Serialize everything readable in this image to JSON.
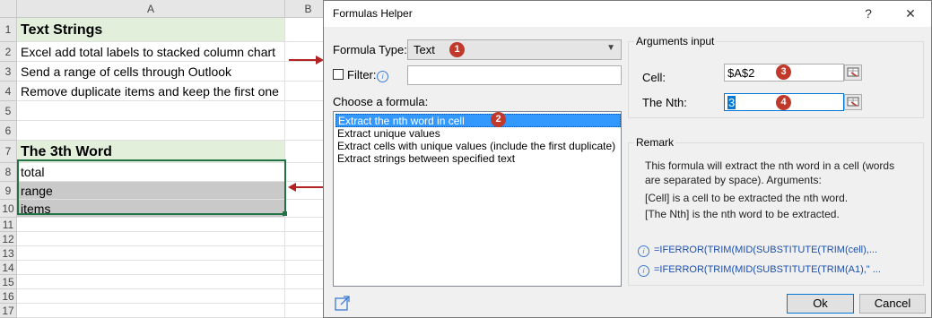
{
  "sheet": {
    "columns": [
      "A",
      "B"
    ],
    "rows": [
      {
        "num": "1",
        "text": "Text Strings"
      },
      {
        "num": "2",
        "text": "Excel add total labels to stacked column chart"
      },
      {
        "num": "3",
        "text": "Send a range of cells through Outlook"
      },
      {
        "num": "4",
        "text": "Remove duplicate items and keep the first one"
      },
      {
        "num": "5",
        "text": ""
      },
      {
        "num": "6",
        "text": ""
      },
      {
        "num": "7",
        "text": "The 3th Word"
      },
      {
        "num": "8",
        "text": "total"
      },
      {
        "num": "9",
        "text": "range"
      },
      {
        "num": "10",
        "text": "items"
      },
      {
        "num": "11",
        "text": ""
      },
      {
        "num": "12",
        "text": ""
      },
      {
        "num": "13",
        "text": ""
      },
      {
        "num": "14",
        "text": ""
      },
      {
        "num": "15",
        "text": ""
      },
      {
        "num": "16",
        "text": ""
      },
      {
        "num": "17",
        "text": ""
      }
    ]
  },
  "dialog": {
    "title": "Formulas Helper",
    "help_glyph": "?",
    "close_glyph": "✕",
    "formula_type_label": "Formula Type:",
    "formula_type_value": "Text",
    "filter_label": "Filter:",
    "choose_label": "Choose a formula:",
    "formulas": [
      "Extract the nth word in cell",
      "Extract unique values",
      "Extract cells with unique values (include the first duplicate)",
      "Extract strings between specified text"
    ],
    "selected_formula_index": 0,
    "arguments_title": "Arguments input",
    "cell_label": "Cell:",
    "cell_value": "$A$2",
    "nth_label": "The Nth:",
    "nth_value": "3",
    "remark_title": "Remark",
    "remark_lines": [
      "This formula will extract the nth word in a cell (words",
      "are separated by space). Arguments:",
      "[Cell] is a cell to be extracted the nth word.",
      "[The Nth] is the nth word to be extracted."
    ],
    "formula_previews": [
      "=IFERROR(TRIM(MID(SUBSTITUTE(TRIM(cell),...",
      "=IFERROR(TRIM(MID(SUBSTITUTE(TRIM(A1),\" ..."
    ],
    "ok_label": "Ok",
    "cancel_label": "Cancel"
  },
  "badges": [
    "1",
    "2",
    "3",
    "4"
  ],
  "colors": {
    "accent_arrow": "#b22222",
    "badge": "#c0392b",
    "selection": "#3399ff",
    "header_green": "#e2efda",
    "excel_green": "#217346"
  }
}
